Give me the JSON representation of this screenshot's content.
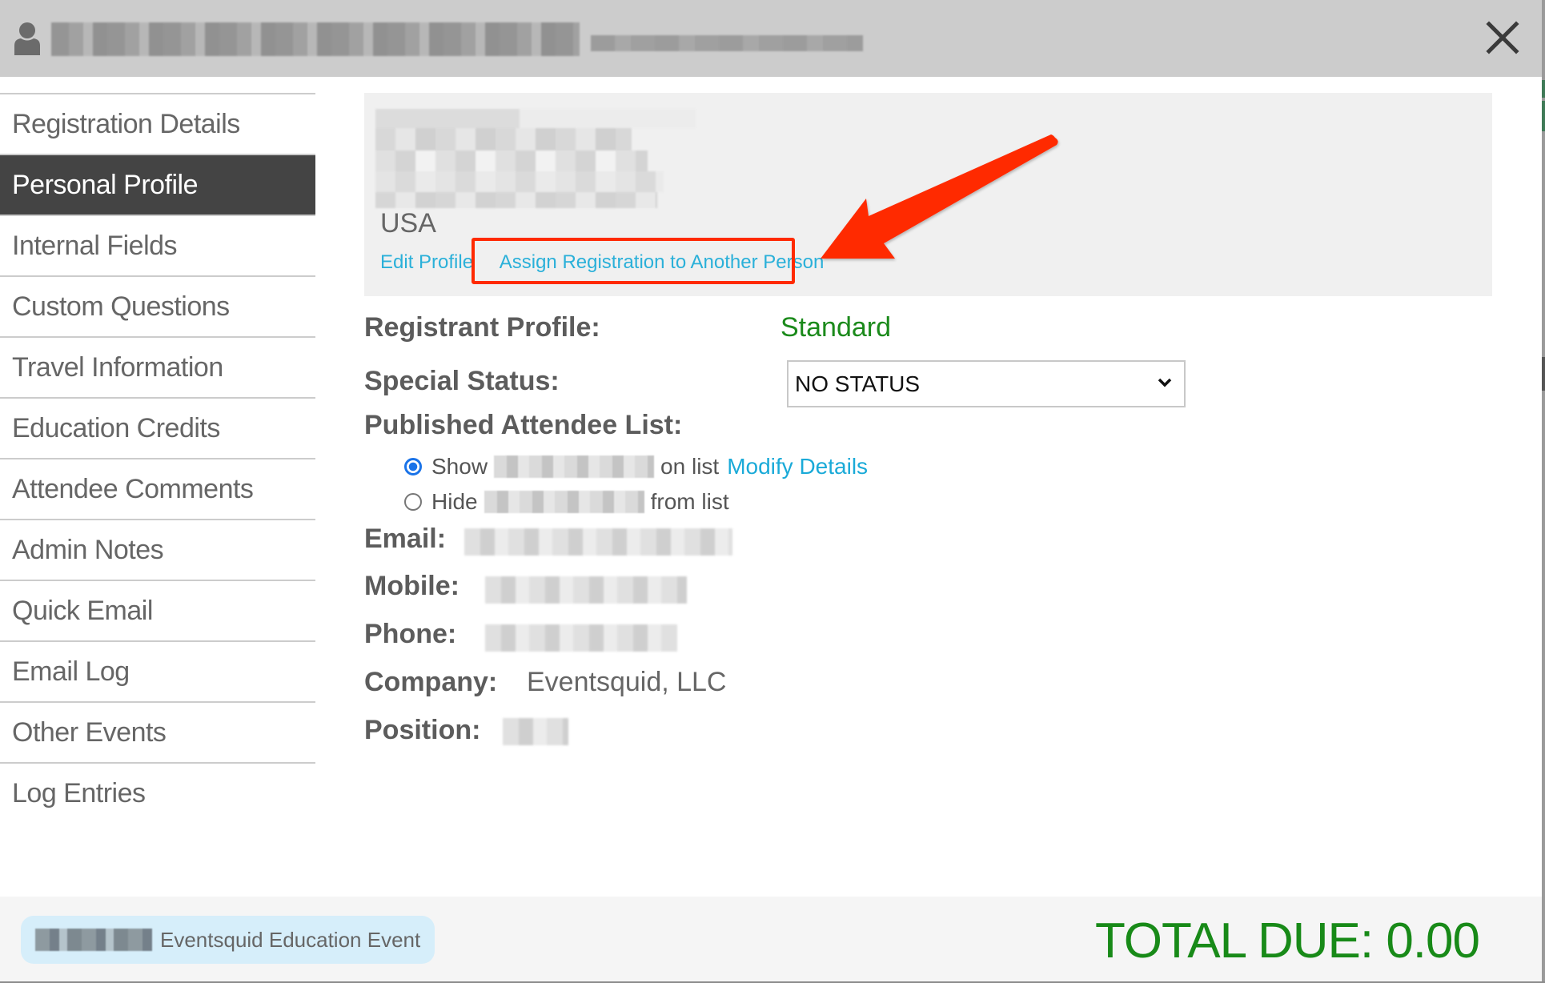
{
  "header": {
    "title_redacted": "[redacted attendee name]",
    "subtitle_redacted": "[redacted]",
    "icons": {
      "user": "user-icon",
      "close": "close-icon"
    }
  },
  "sidebar": {
    "items": [
      {
        "label": "Registration Details",
        "active": false
      },
      {
        "label": "Personal Profile",
        "active": true
      },
      {
        "label": "Internal Fields",
        "active": false
      },
      {
        "label": "Custom Questions",
        "active": false
      },
      {
        "label": "Travel Information",
        "active": false
      },
      {
        "label": "Education Credits",
        "active": false
      },
      {
        "label": "Attendee Comments",
        "active": false
      },
      {
        "label": "Admin Notes",
        "active": false
      },
      {
        "label": "Quick Email",
        "active": false
      },
      {
        "label": "Email Log",
        "active": false
      },
      {
        "label": "Other Events",
        "active": false
      },
      {
        "label": "Log Entries",
        "active": false
      }
    ]
  },
  "profile_box": {
    "address_redacted": "[redacted address]",
    "country": "USA",
    "links": {
      "edit_profile": "Edit Profile",
      "assign_registration": "Assign Registration to Another Person"
    },
    "annotation": {
      "highlight_color": "#ff2a00",
      "arrow_color": "#ff2a00"
    }
  },
  "fields": {
    "registrant_profile": {
      "label": "Registrant Profile:",
      "value": "Standard",
      "value_color": "#1b8a1b"
    },
    "special_status": {
      "label": "Special Status:",
      "selected": "NO STATUS"
    },
    "published_attendee_list": {
      "label": "Published Attendee List:",
      "options": [
        {
          "prefix": "Show",
          "suffix": "on list",
          "checked": true,
          "link": "Modify Details"
        },
        {
          "prefix": "Hide",
          "suffix": "from list",
          "checked": false
        }
      ]
    },
    "email": {
      "label": "Email:",
      "value_redacted": true
    },
    "mobile": {
      "label": "Mobile:",
      "value_redacted": true
    },
    "phone": {
      "label": "Phone:",
      "value_redacted": true
    },
    "company": {
      "label": "Company:",
      "value": "Eventsquid, LLC"
    },
    "position": {
      "label": "Position:",
      "value_redacted": true
    }
  },
  "footer": {
    "event_name": "Eventsquid Education Event",
    "total_due": "TOTAL DUE: 0.00",
    "total_color": "#188a18"
  },
  "colors": {
    "header_bg": "#cccccc",
    "sidebar_active_bg": "#444444",
    "link": "#2ab0d9",
    "badge_bg": "#d6eefa"
  }
}
